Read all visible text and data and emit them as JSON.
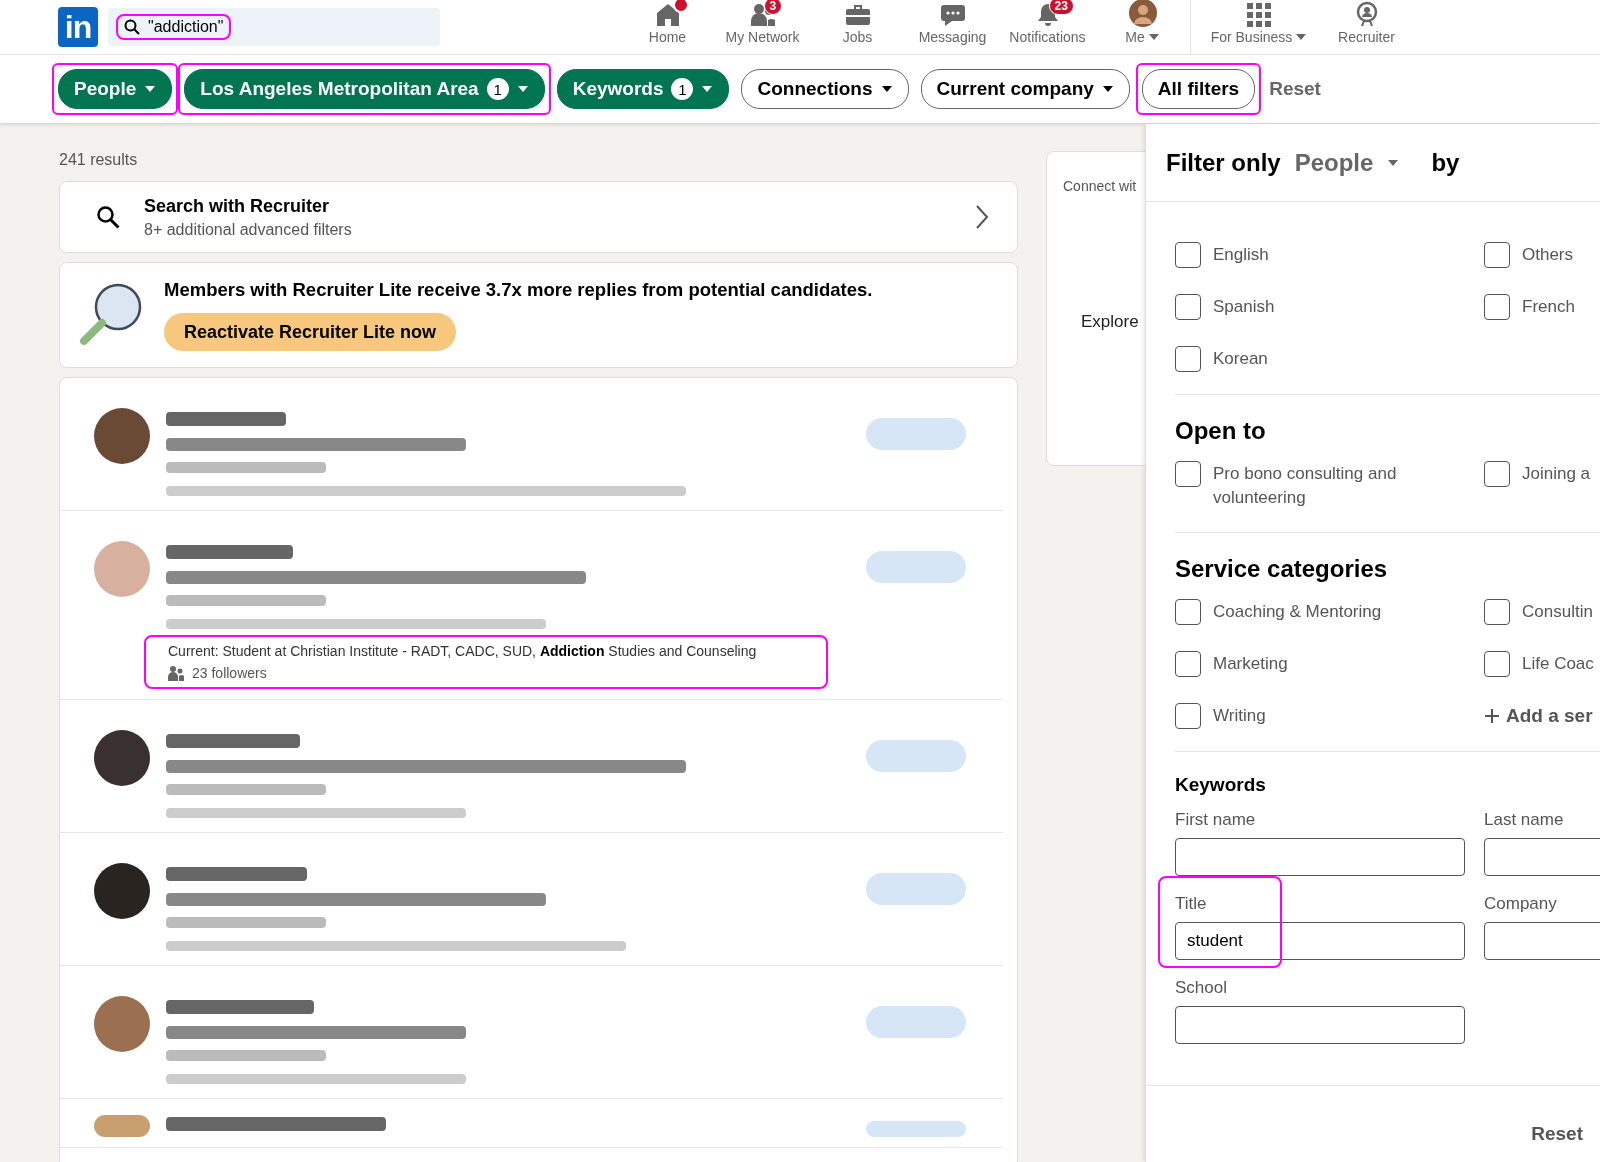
{
  "logo": "in",
  "search": {
    "value": "\"addiction\"",
    "highlighted": true
  },
  "nav": [
    {
      "label": "Home",
      "dot": true,
      "caret": false
    },
    {
      "label": "My Network",
      "badge": "3",
      "dot": false,
      "caret": false
    },
    {
      "label": "Jobs",
      "dot": false,
      "caret": false
    },
    {
      "label": "Messaging",
      "dot": false,
      "caret": false
    },
    {
      "label": "Notifications",
      "badge": "23",
      "dot": false,
      "caret": false
    },
    {
      "label": "Me",
      "dot": false,
      "caret": true
    },
    {
      "label": "For Business",
      "dot": false,
      "caret": true
    },
    {
      "label": "Recruiter",
      "dot": false,
      "caret": false
    }
  ],
  "filters": [
    {
      "label": "People",
      "selected": true,
      "caret": true,
      "highlighted": true
    },
    {
      "label": "Los Angeles Metropolitan Area",
      "count": "1",
      "selected": true,
      "caret": true,
      "highlighted": true
    },
    {
      "label": "Keywords",
      "count": "1",
      "selected": true,
      "caret": true,
      "highlighted": false
    },
    {
      "label": "Connections",
      "selected": false,
      "caret": true,
      "highlighted": false
    },
    {
      "label": "Current company",
      "selected": false,
      "caret": true,
      "highlighted": false
    },
    {
      "label": "All filters",
      "selected": false,
      "caret": false,
      "highlighted": true
    }
  ],
  "reset": "Reset",
  "results_count": "241 results",
  "recruiter_card": {
    "title": "Search with Recruiter",
    "subtitle": "8+ additional advanced filters"
  },
  "promo": {
    "text": "Members with Recruiter Lite receive 3.7x more replies from potential candidates.",
    "button": "Reactivate Recruiter Lite now"
  },
  "results": [
    {
      "kind": "blurred"
    },
    {
      "kind": "partial",
      "snippet": "Current: Student at Christian Institute - RADT, CADC, SUD, **Addiction** Studies and Counseling",
      "followers": "23 followers",
      "highlighted": true
    },
    {
      "kind": "blurred"
    },
    {
      "kind": "blurred"
    },
    {
      "kind": "blurred"
    },
    {
      "kind": "blurred"
    }
  ],
  "side_card": {
    "line_1": "Connect wit",
    "line_2": "Explore"
  },
  "filter_panel": {
    "title": "Filter only",
    "type": "People",
    "by": "by",
    "sections": [
      {
        "kind": "checkboxes",
        "options": [
          {
            "label": "English",
            "checked": false
          },
          {
            "label": "Others",
            "checked": false
          },
          {
            "label": "Spanish",
            "checked": false
          },
          {
            "label": "French",
            "checked": false
          },
          {
            "label": "Korean",
            "checked": false
          }
        ]
      },
      {
        "kind": "checkboxes",
        "heading": "Open to",
        "options": [
          {
            "label": "Pro bono consulting and volunteering",
            "checked": false
          },
          {
            "label": "Joining a",
            "checked": false
          }
        ]
      },
      {
        "kind": "checkboxes",
        "heading": "Service categories",
        "options": [
          {
            "label": "Coaching & Mentoring",
            "checked": false
          },
          {
            "label": "Consultin",
            "checked": false
          },
          {
            "label": "Marketing",
            "checked": false
          },
          {
            "label": "Life Coac",
            "checked": false
          },
          {
            "label": "Writing",
            "checked": false
          }
        ],
        "add_link": "Add a ser"
      },
      {
        "kind": "fields",
        "heading": "Keywords",
        "fields": [
          {
            "label": "First name",
            "highlighted": false
          },
          {
            "label": "Last name",
            "highlighted": false
          },
          {
            "label": "Title",
            "value": "student",
            "highlighted": true
          },
          {
            "label": "Company",
            "highlighted": false
          },
          {
            "label": "School",
            "highlighted": false
          }
        ]
      }
    ],
    "footer_button": "Reset"
  }
}
